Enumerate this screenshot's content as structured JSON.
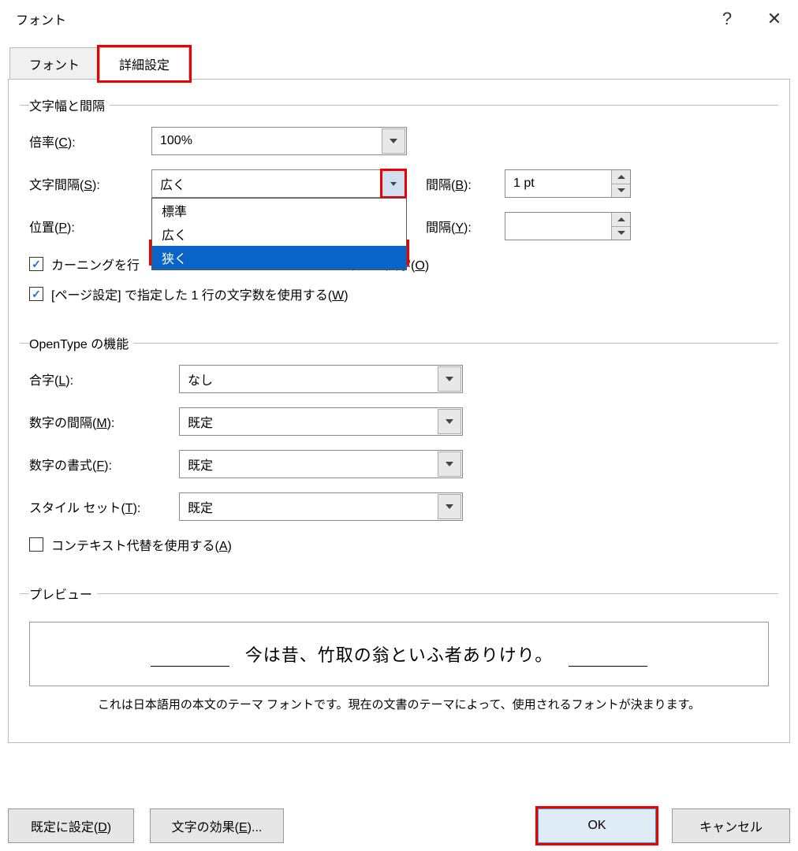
{
  "title": "フォント",
  "help_icon": "?",
  "close_icon": "✕",
  "tabs": {
    "font": "フォント",
    "advanced": "詳細設定"
  },
  "section_spacing": {
    "legend": "文字幅と間隔",
    "scale_label_before": "倍率(",
    "scale_label_key": "C",
    "scale_label_after": "):",
    "scale_value": "100%",
    "spacing_label_before": "文字間隔(",
    "spacing_label_key": "S",
    "spacing_label_after": "):",
    "spacing_value": "広く",
    "spacing_by_label_before": "間隔(",
    "spacing_by_label_key": "B",
    "spacing_by_label_after": "):",
    "spacing_by_value": "1 pt",
    "position_label_before": "位置(",
    "position_label_key": "P",
    "position_label_after": "):",
    "position_by_label_before": "間隔(",
    "position_by_label_key": "Y",
    "position_by_label_after": "):",
    "position_by_value": "",
    "dropdown_items": [
      "標準",
      "広く",
      "狭く"
    ],
    "kerning_label_before": "カーニングを行",
    "kerning_mid": "ポイント以上の文字(",
    "kerning_key": "O",
    "kerning_after": ")",
    "grid_label_before": "[ページ設定] で指定した 1 行の文字数を使用する(",
    "grid_label_key": "W",
    "grid_label_after": ")"
  },
  "section_opentype": {
    "legend": "OpenType の機能",
    "ligatures_label_before": "合字(",
    "ligatures_label_key": "L",
    "ligatures_label_after": "):",
    "ligatures_value": "なし",
    "numspacing_label_before": "数字の間隔(",
    "numspacing_label_key": "M",
    "numspacing_label_after": "):",
    "numspacing_value": "既定",
    "numforms_label_before": "数字の書式(",
    "numforms_label_key": "F",
    "numforms_label_after": "):",
    "numforms_value": "既定",
    "styleset_label_before": "スタイル セット(",
    "styleset_label_key": "T",
    "styleset_label_after": "):",
    "styleset_value": "既定",
    "contextual_label_before": "コンテキスト代替を使用する(",
    "contextual_label_key": "A",
    "contextual_label_after": ")"
  },
  "section_preview": {
    "legend": "プレビュー",
    "sample": "今は昔、竹取の翁といふ者ありけり。",
    "desc": "これは日本語用の本文のテーマ フォントです。現在の文書のテーマによって、使用されるフォントが決まります。"
  },
  "footer": {
    "set_default_before": "既定に設定(",
    "set_default_key": "D",
    "set_default_after": ")",
    "text_effects_before": "文字の効果(",
    "text_effects_key": "E",
    "text_effects_after": ")...",
    "ok": "OK",
    "cancel": "キャンセル"
  }
}
